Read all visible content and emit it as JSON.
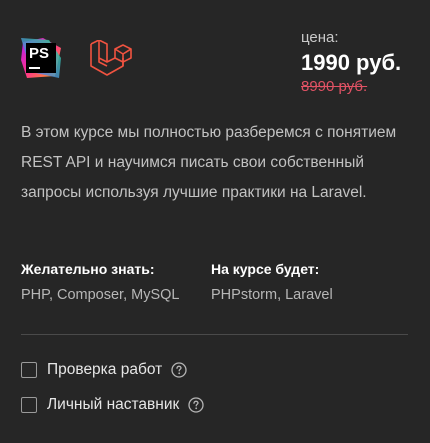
{
  "logos": {
    "phpstorm_text": "PS",
    "phpstorm_icon": "phpstorm-logo-icon",
    "laravel_icon": "laravel-logo-icon"
  },
  "price": {
    "label": "цена:",
    "current": "1990 руб.",
    "old": "8990 руб."
  },
  "description": "В этом курсе мы полностью разберемся с понятием REST API и научимся писать свои собственный запросы используя лучшие практики на Laravel.",
  "requirements": {
    "prereq_title": "Желательно знать:",
    "prereq_value": "PHP, Composer, MySQL",
    "course_title": "На курсе будет:",
    "course_value": "PHPstorm, Laravel"
  },
  "options": [
    {
      "label": "Проверка работ",
      "checked": false,
      "icon": "help-circle-icon"
    },
    {
      "label": "Личный наставник",
      "checked": false,
      "icon": "help-circle-icon"
    }
  ],
  "colors": {
    "background": "#262626",
    "old_price": "#e05264",
    "laravel": "#f05340"
  }
}
